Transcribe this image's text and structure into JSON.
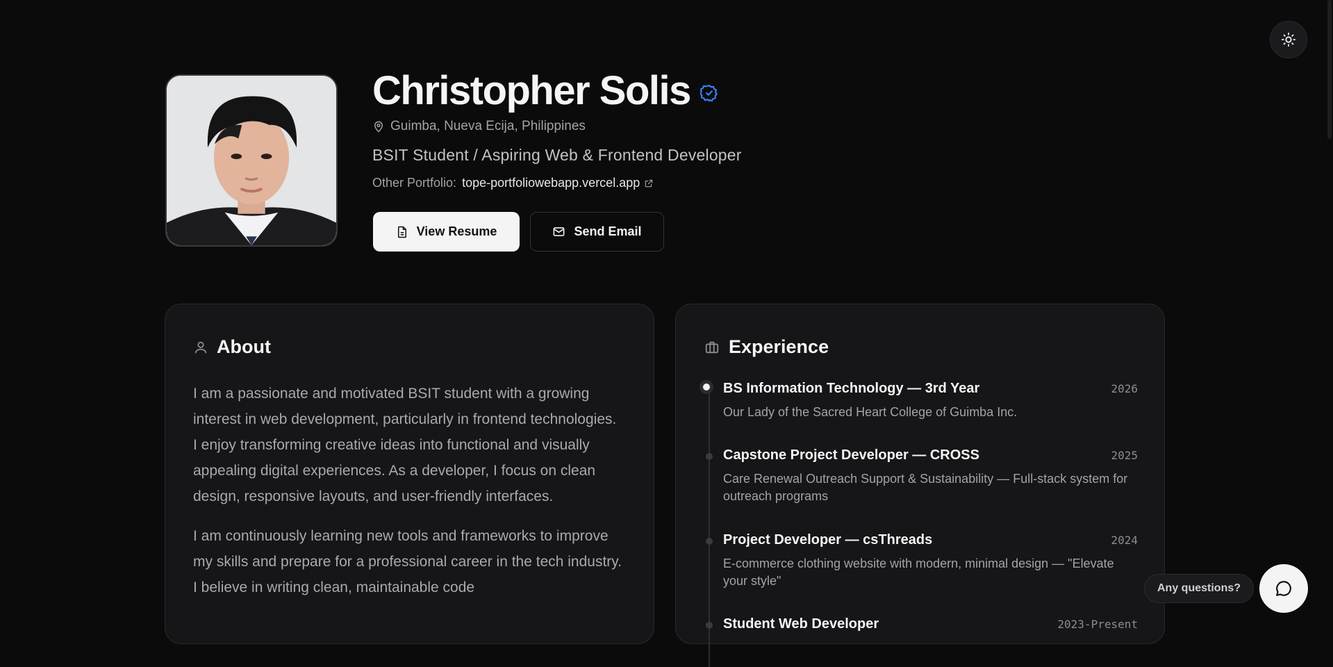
{
  "profile": {
    "name": "Christopher Solis",
    "location": "Guimba, Nueva Ecija, Philippines",
    "role": "BSIT Student / Aspiring Web & Frontend Developer",
    "portfolio_label": "Other Portfolio:",
    "portfolio_link": "tope-portfoliowebapp.vercel.app"
  },
  "buttons": {
    "resume": "View Resume",
    "email": "Send Email"
  },
  "about": {
    "title": "About",
    "paragraphs": [
      "I am a passionate and motivated BSIT student with a growing interest in web development, particularly in frontend technologies. I enjoy transforming creative ideas into functional and visually appealing digital experiences. As a developer, I focus on clean design, responsive layouts, and user-friendly interfaces.",
      "I am continuously learning new tools and frameworks to improve my skills and prepare for a professional career in the tech industry. I believe in writing clean, maintainable code"
    ]
  },
  "experience": {
    "title": "Experience",
    "items": [
      {
        "title": "BS Information Technology — 3rd Year",
        "year": "2026",
        "desc": "Our Lady of the Sacred Heart College of Guimba Inc."
      },
      {
        "title": "Capstone Project Developer — CROSS",
        "year": "2025",
        "desc": "Care Renewal Outreach Support & Sustainability — Full-stack system for outreach programs"
      },
      {
        "title": "Project Developer — csThreads",
        "year": "2024",
        "desc": "E-commerce clothing website with modern, minimal design — \"Elevate your style\""
      },
      {
        "title": "Student Web Developer",
        "year": "2023-Present",
        "desc": ""
      }
    ]
  },
  "chat": {
    "prompt": "Any questions?"
  },
  "colors": {
    "background": "#0b0b0c",
    "card": "#161618",
    "accent_verified": "#3b82f6"
  }
}
